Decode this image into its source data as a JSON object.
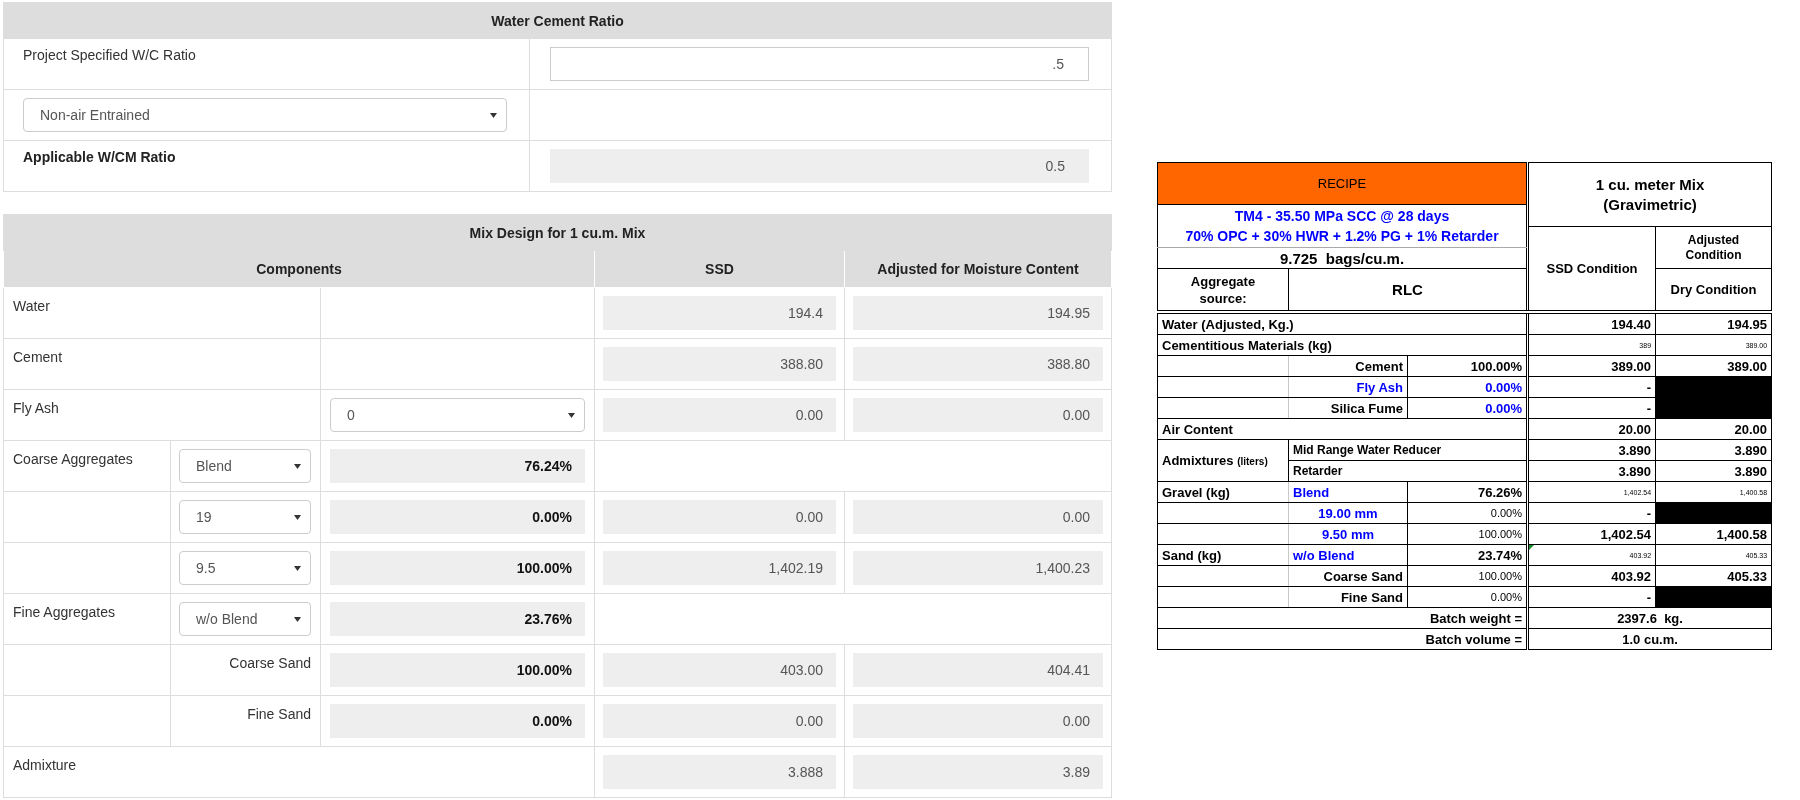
{
  "water_cement_ratio": {
    "title": "Water Cement Ratio",
    "rows": [
      {
        "kind": "input",
        "label": "Project Specified W/C Ratio",
        "value": ".5"
      },
      {
        "kind": "select",
        "value": "Non-air Entrained"
      },
      {
        "kind": "readonly",
        "label": "Applicable W/CM Ratio",
        "value": "0.5"
      }
    ]
  },
  "mix_design": {
    "title": "Mix Design for 1 cu.m. Mix",
    "columns": [
      "Components",
      "SSD",
      "Adjusted for Moisture Content"
    ],
    "rows": [
      {
        "kind": "material",
        "label": "Water",
        "ssd": "194.4",
        "adjusted": "194.95"
      },
      {
        "kind": "material",
        "label": "Cement",
        "ssd": "388.80",
        "adjusted": "388.80"
      },
      {
        "kind": "material",
        "label": "Fly Ash",
        "option": "0",
        "ssd": "0.00",
        "adjusted": "0.00"
      },
      {
        "kind": "group",
        "label": "Coarse Aggregates",
        "option": "Blend",
        "share": "76.24%"
      },
      {
        "kind": "size",
        "option": "19",
        "share": "0.00%",
        "ssd": "0.00",
        "adjusted": "0.00"
      },
      {
        "kind": "size",
        "option": "9.5",
        "share": "100.00%",
        "ssd": "1,402.19",
        "adjusted": "1,400.23"
      },
      {
        "kind": "group",
        "label": "Fine Aggregates",
        "option": "w/o Blend",
        "share": "23.76%"
      },
      {
        "kind": "fraction",
        "label": "Coarse Sand",
        "share": "100.00%",
        "ssd": "403.00",
        "adjusted": "404.41"
      },
      {
        "kind": "fraction",
        "label": "Fine Sand",
        "share": "0.00%",
        "ssd": "0.00",
        "adjusted": "0.00"
      },
      {
        "kind": "additive",
        "label": "Admixture",
        "ssd": "3.888",
        "adjusted": "3.89"
      }
    ]
  },
  "recipe": {
    "title": "RECIPE",
    "mix_name": "TM4 - 35.50 MPa SCC @ 28 days",
    "binder_blend": "70% OPC + 30% HWR + 1.2% PG + 1% Retarder",
    "bags": "9.725  bags/cu.m.",
    "source_label": "Aggregate source:",
    "source": "RLC",
    "mix_heading": "1 cu. meter Mix (Gravimetric)",
    "ssd_header": "SSD Condition",
    "adjusted_header": "Adjusted Condition",
    "dry_header": "Dry Condition",
    "rows": [
      {
        "kind": "total",
        "label": "Water (Adjusted, Kg.)",
        "ssd": "194.40",
        "adjusted": "194.95",
        "masked": false,
        "flagged": false
      },
      {
        "kind": "subtotal",
        "label": "Cementitious Materials (kg)",
        "ssd": "389",
        "adjusted": "389.00",
        "masked": false,
        "flagged": false
      },
      {
        "kind": "material",
        "detail": {
          "text": "Cement",
          "color": "#000000"
        },
        "share": {
          "text": "100.00%",
          "color": "#000000"
        },
        "ssd": "389.00",
        "adjusted": "389.00",
        "masked": false,
        "flagged": false
      },
      {
        "kind": "material",
        "detail": {
          "text": "Fly Ash",
          "color": "#0000ff"
        },
        "share": {
          "text": "0.00%",
          "color": "#0000ff"
        },
        "ssd": "-",
        "masked": true,
        "flagged": false
      },
      {
        "kind": "material",
        "detail": {
          "text": "Silica Fume",
          "color": "#000000"
        },
        "share": {
          "text": "0.00%",
          "color": "#0000ff"
        },
        "ssd": "-",
        "masked": true,
        "flagged": false
      },
      {
        "kind": "total",
        "label": "Air Content",
        "ssd": "20.00",
        "adjusted": "20.00",
        "masked": false,
        "flagged": false
      },
      {
        "kind": "admixture",
        "label": "Admixtures",
        "unit": "(liters)",
        "products": [
          {
            "name": "Mid Range Water Reducer",
            "ssd": "3.890",
            "adjusted": "3.890"
          },
          {
            "name": "Retarder",
            "ssd": "3.890",
            "adjusted": "3.890"
          }
        ],
        "masked": false,
        "flagged": false
      },
      {
        "kind": "group",
        "label": "Gravel (kg)",
        "detail": {
          "text": "Blend",
          "color": "#0000ff"
        },
        "share": {
          "text": "76.26%",
          "color": "#000000"
        },
        "ssd": "1,402.54",
        "adjusted": "1,400.58",
        "masked": false,
        "flagged": false
      },
      {
        "kind": "size",
        "detail": {
          "text": "19.00 mm",
          "color": "#0000ff"
        },
        "share": {
          "text": "0.00%",
          "color": "#000000"
        },
        "ssd": "-",
        "masked": true,
        "flagged": false
      },
      {
        "kind": "size",
        "detail": {
          "text": "9.50 mm",
          "color": "#0000ff"
        },
        "share": {
          "text": "100.00%",
          "color": "#000000"
        },
        "ssd": "1,402.54",
        "adjusted": "1,400.58",
        "masked": false,
        "flagged": false
      },
      {
        "kind": "group",
        "label": "Sand (kg)",
        "detail": {
          "text": "w/o Blend",
          "color": "#0000ff"
        },
        "share": {
          "text": "23.74%",
          "color": "#000000"
        },
        "ssd": "403.92",
        "adjusted": "405.33",
        "masked": false,
        "flagged": true
      },
      {
        "kind": "fraction",
        "detail": {
          "text": "Coarse Sand",
          "color": "#000000"
        },
        "share": {
          "text": "100.00%",
          "color": "#000000"
        },
        "ssd": "403.92",
        "adjusted": "405.33",
        "masked": false,
        "flagged": false
      },
      {
        "kind": "fraction",
        "detail": {
          "text": "Fine Sand",
          "color": "#000000"
        },
        "share": {
          "text": "0.00%",
          "color": "#000000"
        },
        "ssd": "-",
        "masked": true,
        "flagged": false
      },
      {
        "kind": "summary",
        "label": "Batch weight =",
        "value": "2397.6  kg.",
        "masked": false,
        "flagged": false
      },
      {
        "kind": "summary",
        "label": "Batch volume =",
        "value": "1.0 cu.m.",
        "masked": false,
        "flagged": false
      }
    ]
  }
}
